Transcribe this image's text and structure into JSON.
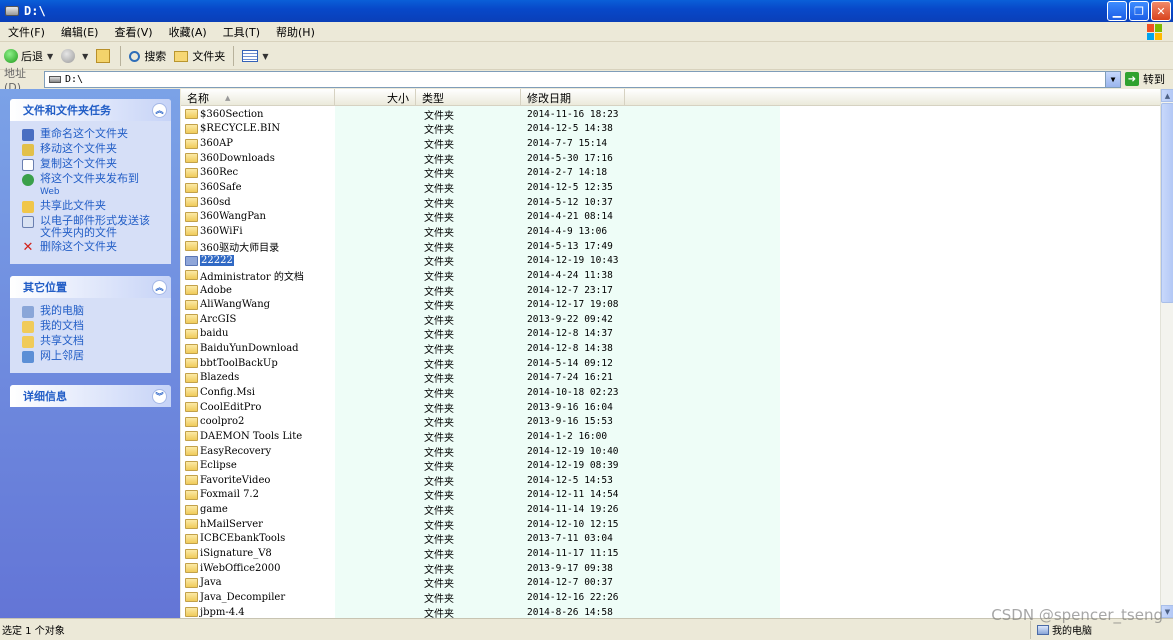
{
  "window": {
    "title": "D:\\"
  },
  "menu": [
    "文件(F)",
    "编辑(E)",
    "查看(V)",
    "收藏(A)",
    "工具(T)",
    "帮助(H)"
  ],
  "toolbar": {
    "back_label": "后退",
    "search_label": "搜索",
    "folders_label": "文件夹"
  },
  "address": {
    "label": "地址(D)",
    "value": "D:\\",
    "go_label": "转到"
  },
  "left_panes": {
    "tasks": {
      "title": "文件和文件夹任务",
      "items": [
        "重命名这个文件夹",
        "移动这个文件夹",
        "复制这个文件夹",
        "将这个文件夹发布到",
        "Web",
        "共享此文件夹",
        "以电子邮件形式发送该",
        "文件夹内的文件",
        "删除这个文件夹"
      ]
    },
    "places": {
      "title": "其它位置",
      "items": [
        "我的电脑",
        "我的文档",
        "共享文档",
        "网上邻居"
      ]
    },
    "details": {
      "title": "详细信息"
    }
  },
  "columns": {
    "name": "名称",
    "size": "大小",
    "type": "类型",
    "modified": "修改日期"
  },
  "files": [
    {
      "name": "$360Section",
      "type": "文件夹",
      "date": "2014-11-16 18:23"
    },
    {
      "name": "$RECYCLE.BIN",
      "type": "文件夹",
      "date": "2014-12-5 14:38"
    },
    {
      "name": "360AP",
      "type": "文件夹",
      "date": "2014-7-7 15:14"
    },
    {
      "name": "360Downloads",
      "type": "文件夹",
      "date": "2014-5-30 17:16"
    },
    {
      "name": "360Rec",
      "type": "文件夹",
      "date": "2014-2-7 14:18"
    },
    {
      "name": "360Safe",
      "type": "文件夹",
      "date": "2014-12-5 12:35"
    },
    {
      "name": "360sd",
      "type": "文件夹",
      "date": "2014-5-12 10:37"
    },
    {
      "name": "360WangPan",
      "type": "文件夹",
      "date": "2014-4-21 08:14"
    },
    {
      "name": "360WiFi",
      "type": "文件夹",
      "date": "2014-4-9 13:06"
    },
    {
      "name": "360驱动大师目录",
      "type": "文件夹",
      "date": "2014-5-13 17:49"
    },
    {
      "name": "22222",
      "type": "文件夹",
      "date": "2014-12-19 10:43",
      "selected": true
    },
    {
      "name": "Administrator 的文档",
      "type": "文件夹",
      "date": "2014-4-24 11:38"
    },
    {
      "name": "Adobe",
      "type": "文件夹",
      "date": "2014-12-7 23:17"
    },
    {
      "name": "AliWangWang",
      "type": "文件夹",
      "date": "2014-12-17 19:08"
    },
    {
      "name": "ArcGIS",
      "type": "文件夹",
      "date": "2013-9-22 09:42"
    },
    {
      "name": "baidu",
      "type": "文件夹",
      "date": "2014-12-8 14:37"
    },
    {
      "name": "BaiduYunDownload",
      "type": "文件夹",
      "date": "2014-12-8 14:38"
    },
    {
      "name": "bbtToolBackUp",
      "type": "文件夹",
      "date": "2014-5-14 09:12"
    },
    {
      "name": "Blazeds",
      "type": "文件夹",
      "date": "2014-7-24 16:21"
    },
    {
      "name": "Config.Msi",
      "type": "文件夹",
      "date": "2014-10-18 02:23"
    },
    {
      "name": "CoolEditPro",
      "type": "文件夹",
      "date": "2013-9-16 16:04"
    },
    {
      "name": "coolpro2",
      "type": "文件夹",
      "date": "2013-9-16 15:53"
    },
    {
      "name": "DAEMON Tools Lite",
      "type": "文件夹",
      "date": "2014-1-2 16:00"
    },
    {
      "name": "EasyRecovery",
      "type": "文件夹",
      "date": "2014-12-19 10:40"
    },
    {
      "name": "Eclipse",
      "type": "文件夹",
      "date": "2014-12-19 08:39"
    },
    {
      "name": "FavoriteVideo",
      "type": "文件夹",
      "date": "2014-12-5 14:53"
    },
    {
      "name": "Foxmail 7.2",
      "type": "文件夹",
      "date": "2014-12-11 14:54"
    },
    {
      "name": "game",
      "type": "文件夹",
      "date": "2014-11-14 19:26"
    },
    {
      "name": "hMailServer",
      "type": "文件夹",
      "date": "2014-12-10 12:15"
    },
    {
      "name": "ICBCEbankTools",
      "type": "文件夹",
      "date": "2013-7-11 03:04"
    },
    {
      "name": "iSignature_V8",
      "type": "文件夹",
      "date": "2014-11-17 11:15"
    },
    {
      "name": "iWebOffice2000",
      "type": "文件夹",
      "date": "2013-9-17 09:38"
    },
    {
      "name": "Java",
      "type": "文件夹",
      "date": "2014-12-7 00:37"
    },
    {
      "name": "Java_Decompiler",
      "type": "文件夹",
      "date": "2014-12-16 22:26"
    },
    {
      "name": "jbpm-4.4",
      "type": "文件夹",
      "date": "2014-8-26 14:58"
    }
  ],
  "status": {
    "left": "选定 1 个对象",
    "right": "我的电脑",
    "watermark": "CSDN @spencer_tseng"
  }
}
